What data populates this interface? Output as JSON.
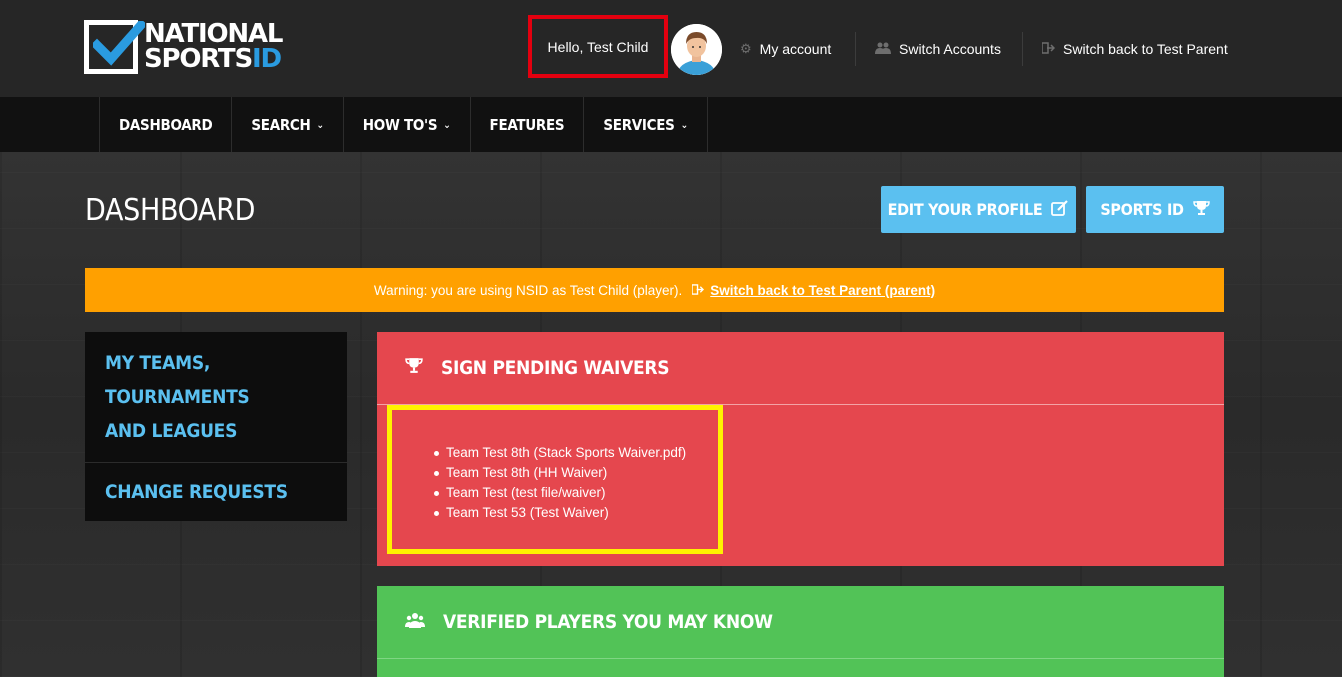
{
  "brand": {
    "line1": "NATIONAL",
    "line2_main": "SPORTS",
    "line2_accent": "ID"
  },
  "header": {
    "greeting": "Hello, Test Child",
    "my_account": "My account",
    "switch_accounts": "Switch Accounts",
    "switch_back": "Switch back to Test Parent"
  },
  "nav": {
    "items": [
      {
        "label": "DASHBOARD",
        "dropdown": false
      },
      {
        "label": "SEARCH",
        "dropdown": true
      },
      {
        "label": "HOW TO'S",
        "dropdown": true
      },
      {
        "label": "FEATURES",
        "dropdown": false
      },
      {
        "label": "SERVICES",
        "dropdown": true
      }
    ]
  },
  "page": {
    "title": "DASHBOARD",
    "edit_profile": "EDIT YOUR PROFILE",
    "sports_id": "SPORTS ID"
  },
  "warning": {
    "text": "Warning: you are using NSID as Test Child (player).",
    "link": "Switch back to Test Parent (parent)"
  },
  "sidebar": {
    "items": [
      {
        "line1": "MY TEAMS, TOURNAMENTS",
        "line2": "AND LEAGUES"
      },
      {
        "line1": "CHANGE REQUESTS",
        "line2": ""
      }
    ]
  },
  "waivers": {
    "title": "SIGN PENDING WAIVERS",
    "items": [
      "Team Test 8th (Stack Sports Waiver.pdf)",
      "Team Test 8th (HH Waiver)",
      "Team Test (test file/waiver)",
      "Team Test 53 (Test Waiver)"
    ]
  },
  "players": {
    "title": "VERIFIED PLAYERS YOU MAY KNOW"
  },
  "colors": {
    "accent_blue": "#5bc0f0",
    "warning_orange": "#ffa000",
    "panel_red": "#e5474e",
    "panel_green": "#52c357",
    "highlight_red": "#e3000f",
    "highlight_yellow": "#fff200"
  }
}
